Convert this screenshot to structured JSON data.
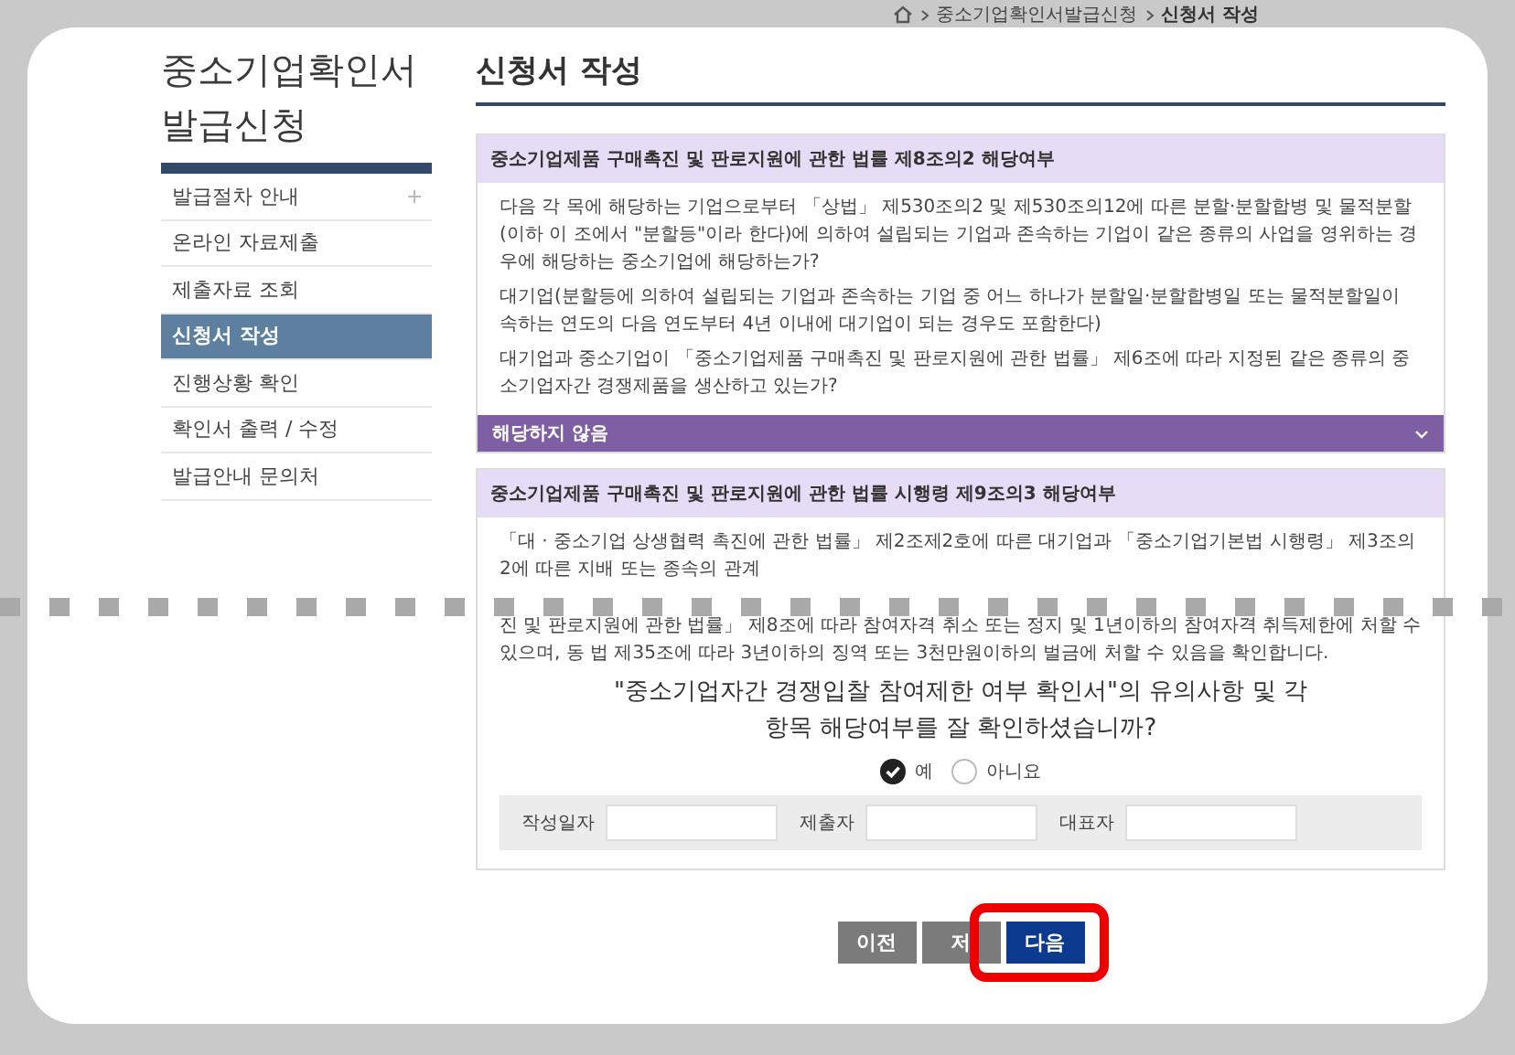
{
  "breadcrumb": [
    {
      "text": "중소기업확인서발급신청",
      "current": false
    },
    {
      "text": "신청서 작성",
      "current": true
    }
  ],
  "sidebar": {
    "title": "중소기업확인서 발급신청",
    "items": [
      {
        "label": "발급절차 안내",
        "selected": false,
        "has_submenu": true
      },
      {
        "label": "온라인 자료제출",
        "selected": false,
        "has_submenu": false
      },
      {
        "label": "제출자료 조회",
        "selected": false,
        "has_submenu": false
      },
      {
        "label": "신청서 작성",
        "selected": true,
        "has_submenu": false
      },
      {
        "label": "진행상황 확인",
        "selected": false,
        "has_submenu": false
      },
      {
        "label": "확인서 출력 / 수정",
        "selected": false,
        "has_submenu": false
      },
      {
        "label": "발급안내 문의처",
        "selected": false,
        "has_submenu": false
      }
    ]
  },
  "page_title": "신청서 작성",
  "sections": [
    {
      "heading": "중소기업제품 구매촉진 및 판로지원에 관한 법률 제8조의2 해당여부",
      "paragraphs": [
        "다음 각 목에 해당하는 기업으로부터 「상법」 제530조의2 및 제530조의12에 따른 분할·분할합병 및 물적분할(이하 이 조에서 \"분할등\"이라 한다)에 의하여 설립되는 기업과 존속하는 기업이 같은 종류의 사업을 영위하는 경우에 해당하는 중소기업에 해당하는가?",
        "대기업(분할등에 의하여 설립되는 기업과 존속하는 기업 중 어느 하나가 분할일·분할합병일 또는 물적분할일이 속하는 연도의 다음 연도부터 4년 이내에 대기업이 되는 경우도 포함한다)",
        "대기업과 중소기업이 「중소기업제품 구매촉진 및 판로지원에 관한 법률」 제6조에 따라 지정된 같은 종류의 중소기업자간 경쟁제품을 생산하고 있는가?"
      ],
      "dropdown": {
        "value": "해당하지 않음",
        "expanded": false
      }
    },
    {
      "heading": "중소기업제품 구매촉진 및 판로지원에 관한 법률 시행령 제9조의3 해당여부",
      "paragraphs": [
        "「대 · 중소기업 상생협력 촉진에 관한 법률」 제2조제2호에 따른 대기업과 「중소기업기본법 시행령」 제3조의2에 따른 지배 또는 종속의 관계",
        "진 및 판로지원에 관한 법률」 제8조에 따라 참여자격 취소 또는 정지 및 1년이하의 참여자격 취득제한에 처할 수 있으며, 동 법 제35조에 따라 3년이하의 징역 또는 3천만원이하의 벌금에 처할 수 있음을 확인합니다."
      ],
      "question": "\"중소기업자간 경쟁입찰 참여제한 여부 확인서\"의 유의사항 및 각 항목 해당여부를 잘 확인하셨습니까?",
      "options": [
        {
          "label": "예",
          "selected": true
        },
        {
          "label": "아니요",
          "selected": false
        }
      ],
      "fields": [
        {
          "label": "작성일자"
        },
        {
          "label": "제출자"
        },
        {
          "label": "대표자"
        }
      ]
    }
  ],
  "buttons": [
    {
      "label": "이전",
      "kind": "secondary",
      "highlighted": false
    },
    {
      "label": "저",
      "kind": "secondary",
      "highlighted": false
    },
    {
      "label": "다음",
      "kind": "primary",
      "highlighted": true
    }
  ]
}
